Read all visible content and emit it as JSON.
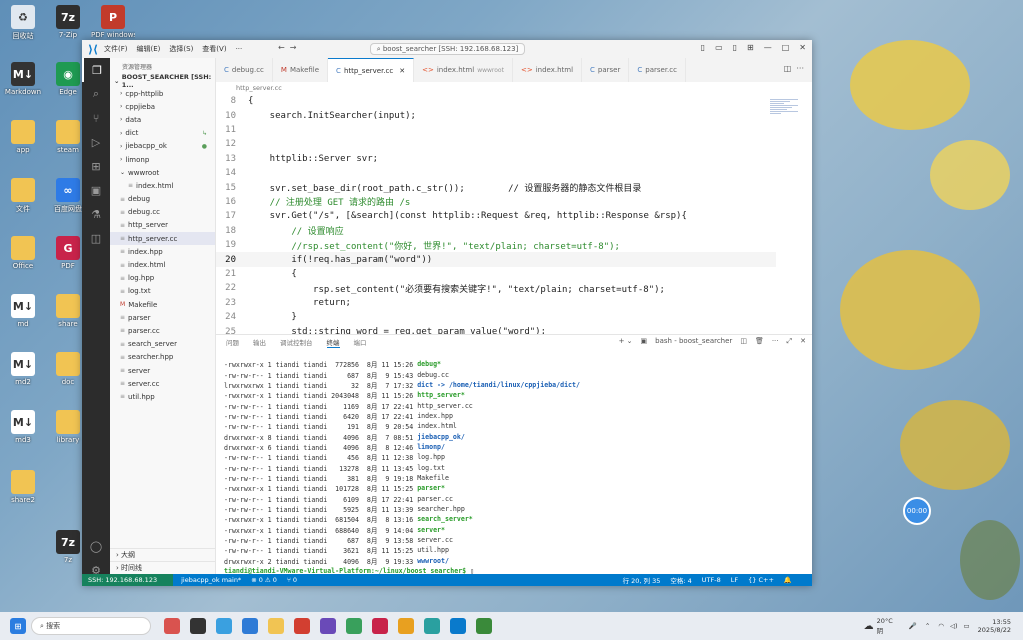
{
  "desktop": {
    "icons": [
      {
        "label": "回收站",
        "color": "#e0e8f0",
        "glyph": "♻"
      },
      {
        "label": "7-Zip",
        "color": "#2f2f2f",
        "glyph": "7z"
      },
      {
        "label": "PDF windows",
        "color": "#c23b2b",
        "glyph": "P"
      },
      {
        "label": "Markdown",
        "color": "#333333",
        "glyph": "M↓"
      },
      {
        "label": "Edge",
        "color": "#1f9a52",
        "glyph": "◉"
      },
      {
        "label": "app",
        "color": "#f1c453",
        "glyph": ""
      },
      {
        "label": "steam",
        "color": "#f1c453",
        "glyph": ""
      },
      {
        "label": "文件",
        "color": "#f1c453",
        "glyph": ""
      },
      {
        "label": "百度网盘",
        "color": "#2e7be6",
        "glyph": "∞"
      },
      {
        "label": "Office",
        "color": "#f1c453",
        "glyph": ""
      },
      {
        "label": "PDF",
        "color": "#c8234a",
        "glyph": "G"
      },
      {
        "label": "md",
        "color": "#ffffff",
        "glyph": "M↓"
      },
      {
        "label": "share",
        "color": "#f1c453",
        "glyph": ""
      },
      {
        "label": "md2",
        "color": "#ffffff",
        "glyph": "M↓"
      },
      {
        "label": "doc",
        "color": "#f1c453",
        "glyph": ""
      },
      {
        "label": "md3",
        "color": "#ffffff",
        "glyph": "M↓"
      },
      {
        "label": "library",
        "color": "#f1c453",
        "glyph": ""
      },
      {
        "label": "share2",
        "color": "#f1c453",
        "glyph": ""
      },
      {
        "label": "7z",
        "color": "#2f2f2f",
        "glyph": "7z"
      }
    ]
  },
  "window": {
    "menu": [
      "文件(F)",
      "编辑(E)",
      "选择(S)",
      "查看(V)",
      "···"
    ],
    "command_center": "boost_searcher [SSH: 192.168.68.123]"
  },
  "sidebar": {
    "header": "资源管理器",
    "root": "BOOST_SEARCHER [SSH: 1...",
    "items": [
      {
        "label": "cpp-httplib",
        "kind": "folder",
        "indent": 1,
        "badge": ""
      },
      {
        "label": "cppjieba",
        "kind": "folder",
        "indent": 1,
        "badge": ""
      },
      {
        "label": "data",
        "kind": "folder",
        "indent": 1,
        "badge": ""
      },
      {
        "label": "dict",
        "kind": "folder",
        "indent": 1,
        "badge": "↳"
      },
      {
        "label": "jiebacpp_ok",
        "kind": "folder",
        "indent": 1,
        "badge": "●"
      },
      {
        "label": "limonp",
        "kind": "folder",
        "indent": 1,
        "badge": ""
      },
      {
        "label": "wwwroot",
        "kind": "folder-open",
        "indent": 1,
        "badge": ""
      },
      {
        "label": "index.html",
        "kind": "file",
        "indent": 2,
        "badge": ""
      },
      {
        "label": "debug",
        "kind": "file",
        "indent": 1,
        "badge": ""
      },
      {
        "label": "debug.cc",
        "kind": "file",
        "indent": 1,
        "badge": ""
      },
      {
        "label": "http_server",
        "kind": "file",
        "indent": 1,
        "badge": ""
      },
      {
        "label": "http_server.cc",
        "kind": "file",
        "indent": 1,
        "badge": ""
      },
      {
        "label": "index.hpp",
        "kind": "file",
        "indent": 1,
        "badge": ""
      },
      {
        "label": "index.html",
        "kind": "file",
        "indent": 1,
        "badge": ""
      },
      {
        "label": "log.hpp",
        "kind": "file",
        "indent": 1,
        "badge": ""
      },
      {
        "label": "log.txt",
        "kind": "file",
        "indent": 1,
        "badge": ""
      },
      {
        "label": "Makefile",
        "kind": "make",
        "indent": 1,
        "badge": ""
      },
      {
        "label": "parser",
        "kind": "file",
        "indent": 1,
        "badge": ""
      },
      {
        "label": "parser.cc",
        "kind": "file",
        "indent": 1,
        "badge": ""
      },
      {
        "label": "search_server",
        "kind": "file",
        "indent": 1,
        "badge": ""
      },
      {
        "label": "searcher.hpp",
        "kind": "file",
        "indent": 1,
        "badge": ""
      },
      {
        "label": "server",
        "kind": "file",
        "indent": 1,
        "badge": ""
      },
      {
        "label": "server.cc",
        "kind": "file",
        "indent": 1,
        "badge": ""
      },
      {
        "label": "util.hpp",
        "kind": "file",
        "indent": 1,
        "badge": ""
      }
    ],
    "selected_index": 11,
    "footer": [
      "大纲",
      "时间线"
    ]
  },
  "tabs": [
    {
      "label": "debug.cc",
      "sub": "",
      "active": false
    },
    {
      "label": "Makefile",
      "sub": "",
      "active": false
    },
    {
      "label": "http_server.cc",
      "sub": "",
      "active": true
    },
    {
      "label": "index.html",
      "sub": "wwwroot",
      "active": false
    },
    {
      "label": "index.html",
      "sub": "",
      "active": false
    },
    {
      "label": "parser",
      "sub": "",
      "active": false
    },
    {
      "label": "parser.cc",
      "sub": "",
      "active": false
    }
  ],
  "breadcrumb": "http_server.cc",
  "editor": {
    "current_line": 20,
    "lines": [
      {
        "n": "8",
        "text": "{"
      },
      {
        "n": "10",
        "text": "    search.InitSearcher(input);"
      },
      {
        "n": "11",
        "text": ""
      },
      {
        "n": "12",
        "text": ""
      },
      {
        "n": "13",
        "text": "    httplib::Server svr;"
      },
      {
        "n": "14",
        "text": ""
      },
      {
        "n": "15",
        "text": "    svr.set_base_dir(root_path.c_str());        // 设置服务器的静态文件根目录"
      },
      {
        "n": "16",
        "text": "    // 注册处理 GET 请求的路由 /s"
      },
      {
        "n": "17",
        "text": "    svr.Get(\"/s\", [&search](const httplib::Request &req, httplib::Response &rsp){"
      },
      {
        "n": "18",
        "text": "        // 设置响应"
      },
      {
        "n": "19",
        "text": "        //rsp.set_content(\"你好, 世界!\", \"text/plain; charset=utf-8\");"
      },
      {
        "n": "20",
        "text": "        if(!req.has_param(\"word\"))"
      },
      {
        "n": "21",
        "text": "        {"
      },
      {
        "n": "22",
        "text": "            rsp.set_content(\"必须要有搜索关键字!\", \"text/plain; charset=utf-8\");"
      },
      {
        "n": "23",
        "text": "            return;"
      },
      {
        "n": "24",
        "text": "        }"
      },
      {
        "n": "25",
        "text": "        std::string word = req.get_param_value(\"word\");"
      }
    ]
  },
  "panel": {
    "tabs": [
      "问题",
      "输出",
      "调试控制台",
      "终端",
      "端口"
    ],
    "active_tab": 3,
    "terminal_label": "bash - boost_searcher",
    "lines": [
      {
        "perm": "-rwxrwxr-x 1 tiandi tiandi  772856  8月 11 15:26 ",
        "name": "debug*",
        "style": "g"
      },
      {
        "perm": "-rw-rw-r-- 1 tiandi tiandi     687  8月  9 15:43 ",
        "name": "debug.cc",
        "style": ""
      },
      {
        "perm": "lrwxrwxrwx 1 tiandi tiandi      32  8月  7 17:32 ",
        "name": "dict -> /home/tiandi/linux/cppjieba/dict/",
        "style": "b"
      },
      {
        "perm": "-rwxrwxr-x 1 tiandi tiandi 2043048  8月 11 15:26 ",
        "name": "http_server*",
        "style": "g"
      },
      {
        "perm": "-rw-rw-r-- 1 tiandi tiandi    1169  8月 17 22:41 ",
        "name": "http_server.cc",
        "style": ""
      },
      {
        "perm": "-rw-rw-r-- 1 tiandi tiandi    6420  8月 17 22:41 ",
        "name": "index.hpp",
        "style": ""
      },
      {
        "perm": "-rw-rw-r-- 1 tiandi tiandi     191  8月  9 20:54 ",
        "name": "index.html",
        "style": ""
      },
      {
        "perm": "drwxrwxr-x 8 tiandi tiandi    4096  8月  7 08:51 ",
        "name": "jiebacpp_ok/",
        "style": "b"
      },
      {
        "perm": "drwxrwxr-x 6 tiandi tiandi    4096  8月  8 12:46 ",
        "name": "limonp/",
        "style": "b"
      },
      {
        "perm": "-rw-rw-r-- 1 tiandi tiandi     456  8月 11 12:38 ",
        "name": "log.hpp",
        "style": ""
      },
      {
        "perm": "-rw-rw-r-- 1 tiandi tiandi   13278  8月 11 13:45 ",
        "name": "log.txt",
        "style": ""
      },
      {
        "perm": "-rw-rw-r-- 1 tiandi tiandi     381  8月  9 19:18 ",
        "name": "Makefile",
        "style": ""
      },
      {
        "perm": "-rwxrwxr-x 1 tiandi tiandi  101728  8月 11 15:25 ",
        "name": "parser*",
        "style": "g"
      },
      {
        "perm": "-rw-rw-r-- 1 tiandi tiandi    6109  8月 17 22:41 ",
        "name": "parser.cc",
        "style": ""
      },
      {
        "perm": "-rw-rw-r-- 1 tiandi tiandi    5925  8月 11 13:39 ",
        "name": "searcher.hpp",
        "style": ""
      },
      {
        "perm": "-rwxrwxr-x 1 tiandi tiandi  681504  8月  8 13:16 ",
        "name": "search_server*",
        "style": "g"
      },
      {
        "perm": "-rwxrwxr-x 1 tiandi tiandi  688640  8月  9 14:04 ",
        "name": "server*",
        "style": "g"
      },
      {
        "perm": "-rw-rw-r-- 1 tiandi tiandi     687  8月  9 13:58 ",
        "name": "server.cc",
        "style": ""
      },
      {
        "perm": "-rw-rw-r-- 1 tiandi tiandi    3621  8月 11 15:25 ",
        "name": "util.hpp",
        "style": ""
      },
      {
        "perm": "drwxrwxr-x 2 tiandi tiandi    4096  8月  9 19:33 ",
        "name": "wwwroot/",
        "style": "b"
      }
    ],
    "prompt": "tiandi@tiandi-VMware-Virtual-Platform:~/linux/boost_searcher$ "
  },
  "statusbar": {
    "remote": "SSH: 192.168.68.123",
    "branch": "jiebacpp_ok  main*",
    "problems": "⊗ 0 ⚠ 0",
    "ports": "⑂ 0",
    "position": "行 20, 列 35",
    "spaces": "空格: 4",
    "encoding": "UTF-8",
    "eol": "LF",
    "language": "{} C++"
  },
  "recorder": "00:00",
  "taskbar": {
    "search_placeholder": "搜索",
    "weather_temp": "20°C",
    "weather_desc": "阴",
    "time": "13:55",
    "date": "2025/8/22",
    "apps": [
      "#d9534f",
      "#333",
      "#3aa0e0",
      "#2f7bd6",
      "#f1c453",
      "#d23f31",
      "#6a4ab8",
      "#39a05c",
      "#c8234a",
      "#e8a020",
      "#2aa0a0",
      "#0a7acc",
      "#3a8a3a"
    ]
  }
}
